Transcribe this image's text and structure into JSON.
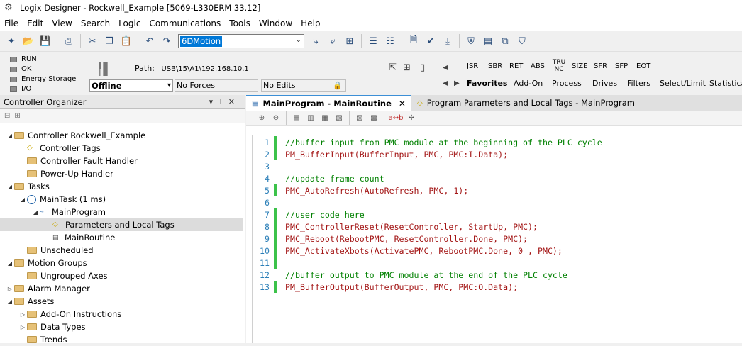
{
  "window": {
    "title": "Logix Designer - Rockwell_Example [5069-L330ERM 33.12]"
  },
  "menu": [
    "File",
    "Edit",
    "View",
    "Search",
    "Logic",
    "Communications",
    "Tools",
    "Window",
    "Help"
  ],
  "toolbar": {
    "search_value": "6DMotion"
  },
  "status": {
    "leds": [
      "RUN",
      "OK",
      "Energy Storage",
      "I/O"
    ],
    "path_label": "Path:",
    "path_value": "USB\\15\\A1\\192.168.10.1",
    "mode": "Offline",
    "forces": "No Forces",
    "edits": "No Edits"
  },
  "instructions": {
    "items": [
      "JSR",
      "SBR",
      "RET",
      "ABS",
      "TRU NC",
      "SIZE",
      "SFR",
      "SFP",
      "EOT"
    ],
    "tabs": [
      "Favorites",
      "Add-On",
      "Process",
      "Drives",
      "Filters",
      "Select/Limit",
      "Statistical"
    ]
  },
  "organizer": {
    "title": "Controller Organizer",
    "tree": [
      {
        "label": "Controller Rockwell_Example",
        "level": 0,
        "icon": "folder",
        "expand": "open"
      },
      {
        "label": "Controller Tags",
        "level": 1,
        "icon": "tag",
        "expand": ""
      },
      {
        "label": "Controller Fault Handler",
        "level": 1,
        "icon": "folder",
        "expand": ""
      },
      {
        "label": "Power-Up Handler",
        "level": 1,
        "icon": "folder",
        "expand": ""
      },
      {
        "label": "Tasks",
        "level": 0,
        "icon": "folder",
        "expand": "open"
      },
      {
        "label": "MainTask (1 ms)",
        "level": 1,
        "icon": "clock",
        "expand": "open"
      },
      {
        "label": "MainProgram",
        "level": 2,
        "icon": "program",
        "expand": "open"
      },
      {
        "label": "Parameters and Local Tags",
        "level": 3,
        "icon": "tag",
        "expand": "",
        "selected": true
      },
      {
        "label": "MainRoutine",
        "level": 3,
        "icon": "routine",
        "expand": ""
      },
      {
        "label": "Unscheduled",
        "level": 1,
        "icon": "folder",
        "expand": ""
      },
      {
        "label": "Motion Groups",
        "level": 0,
        "icon": "folder",
        "expand": "open"
      },
      {
        "label": "Ungrouped Axes",
        "level": 1,
        "icon": "folder",
        "expand": ""
      },
      {
        "label": "Alarm Manager",
        "level": 0,
        "icon": "folder",
        "expand": "closed"
      },
      {
        "label": "Assets",
        "level": 0,
        "icon": "folder",
        "expand": "open"
      },
      {
        "label": "Add-On Instructions",
        "level": 1,
        "icon": "folder",
        "expand": "closed"
      },
      {
        "label": "Data Types",
        "level": 1,
        "icon": "folder",
        "expand": "closed"
      },
      {
        "label": "Trends",
        "level": 1,
        "icon": "folder",
        "expand": ""
      }
    ]
  },
  "editor": {
    "tabs": [
      {
        "label": "MainProgram - MainRoutine",
        "active": true
      },
      {
        "label": "Program Parameters and Local Tags - MainProgram",
        "active": false
      }
    ],
    "lines": [
      {
        "n": "1",
        "text": "//buffer input from PMC module at the beginning of the PLC cycle",
        "kind": "comment",
        "bar": true
      },
      {
        "n": "2",
        "fn": "PM_BufferInput",
        "args": "(BufferInput, PMC, PMC:I.Data);",
        "kind": "code",
        "bar": true
      },
      {
        "n": "3",
        "text": "",
        "kind": "blank",
        "bar": false
      },
      {
        "n": "4",
        "text": "//update frame count",
        "kind": "comment",
        "bar": false
      },
      {
        "n": "5",
        "fn": "PMC_AutoRefresh",
        "args": "(AutoRefresh, PMC, 1);",
        "kind": "code",
        "bar": true
      },
      {
        "n": "6",
        "text": "",
        "kind": "blank",
        "bar": false
      },
      {
        "n": "7",
        "text": "//user code here",
        "kind": "comment",
        "bar": true
      },
      {
        "n": "8",
        "fn": "PMC_ControllerReset",
        "args": "(ResetController, StartUp, PMC);",
        "kind": "code",
        "bar": true
      },
      {
        "n": "9",
        "fn": "PMC_Reboot",
        "args": "(RebootPMC, ResetController.Done, PMC);",
        "kind": "code",
        "bar": true
      },
      {
        "n": "10",
        "fn": "PMC_ActivateXbots",
        "args": "(ActivatePMC, RebootPMC.Done, 0 , PMC);",
        "kind": "code",
        "bar": true
      },
      {
        "n": "11",
        "text": "",
        "kind": "blank",
        "bar": true
      },
      {
        "n": "12",
        "text": "//buffer output to PMC module at the end of the PLC cycle",
        "kind": "comment",
        "bar": false
      },
      {
        "n": "13",
        "fn": "PM_BufferOutput",
        "args": "(BufferOutput, PMC, PMC:O.Data);",
        "kind": "code",
        "bar": true
      }
    ]
  }
}
